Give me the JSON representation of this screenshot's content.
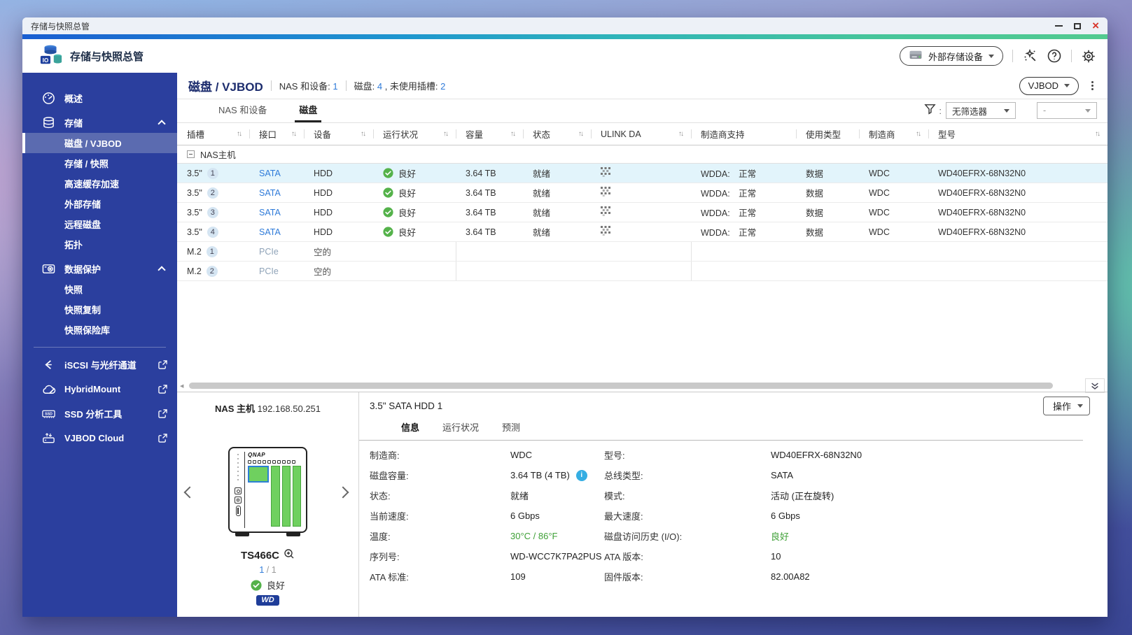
{
  "window": {
    "title": "存储与快照总管"
  },
  "app_header": {
    "title": "存储与快照总管",
    "external_device_button": "外部存储设备",
    "icons": {
      "logo": "storage-io-logo",
      "magic": "wand-icon",
      "help": "question-icon",
      "settings": "gear-icon"
    }
  },
  "sidebar": {
    "items": [
      {
        "label": "概述"
      },
      {
        "label": "存储"
      },
      {
        "label": "磁盘 / VJBOD"
      },
      {
        "label": "存储 / 快照"
      },
      {
        "label": "高速缓存加速"
      },
      {
        "label": "外部存储"
      },
      {
        "label": "远程磁盘"
      },
      {
        "label": "拓扑"
      },
      {
        "label": "数据保护"
      },
      {
        "label": "快照"
      },
      {
        "label": "快照复制"
      },
      {
        "label": "快照保险库"
      },
      {
        "label": "iSCSI 与光纤通道"
      },
      {
        "label": "HybridMount"
      },
      {
        "label": "SSD 分析工具"
      },
      {
        "label": "VJBOD Cloud"
      }
    ]
  },
  "page": {
    "title": "磁盘 / VJBOD",
    "stat_nas_label": "NAS 和设备:",
    "stat_nas_value": "1",
    "stat_disk_label": "磁盘:",
    "stat_disk_value": "4",
    "stat_unused_label": ", 未使用插槽:",
    "stat_unused_value": "2",
    "vjbod_button": "VJBOD"
  },
  "tabs": {
    "devices": "NAS 和设备",
    "disks": "磁盘"
  },
  "filter": {
    "primary": "无筛选器",
    "secondary": "-"
  },
  "table": {
    "group_label": "NAS主机",
    "columns": [
      {
        "label": "插槽"
      },
      {
        "label": "接口"
      },
      {
        "label": "设备"
      },
      {
        "label": "运行状况"
      },
      {
        "label": "容量"
      },
      {
        "label": "状态"
      },
      {
        "label": "ULINK DA"
      },
      {
        "label": "制造商支持"
      },
      {
        "label": "使用类型"
      },
      {
        "label": "制造商"
      },
      {
        "label": "型号"
      }
    ],
    "rows": [
      {
        "slot": "3.5\"",
        "num": "1",
        "iface": "SATA",
        "device": "HDD",
        "health": "良好",
        "capacity": "3.64 TB",
        "status": "就绪",
        "support": "WDDA:　正常",
        "usage": "数据",
        "mfr": "WDC",
        "model": "WD40EFRX-68N32N0"
      },
      {
        "slot": "3.5\"",
        "num": "2",
        "iface": "SATA",
        "device": "HDD",
        "health": "良好",
        "capacity": "3.64 TB",
        "status": "就绪",
        "support": "WDDA:　正常",
        "usage": "数据",
        "mfr": "WDC",
        "model": "WD40EFRX-68N32N0"
      },
      {
        "slot": "3.5\"",
        "num": "3",
        "iface": "SATA",
        "device": "HDD",
        "health": "良好",
        "capacity": "3.64 TB",
        "status": "就绪",
        "support": "WDDA:　正常",
        "usage": "数据",
        "mfr": "WDC",
        "model": "WD40EFRX-68N32N0"
      },
      {
        "slot": "3.5\"",
        "num": "4",
        "iface": "SATA",
        "device": "HDD",
        "health": "良好",
        "capacity": "3.64 TB",
        "status": "就绪",
        "support": "WDDA:　正常",
        "usage": "数据",
        "mfr": "WDC",
        "model": "WD40EFRX-68N32N0"
      },
      {
        "slot": "M.2",
        "num": "1",
        "iface": "PCIe",
        "device": "空的"
      },
      {
        "slot": "M.2",
        "num": "2",
        "iface": "PCIe",
        "device": "空的"
      }
    ]
  },
  "bottom": {
    "nas": {
      "label": "NAS 主机",
      "ip": "192.168.50.251",
      "brand": "QNAP",
      "model": "TS466C",
      "page_current": "1",
      "page_rest": " / 1",
      "health": "良好",
      "wd_logo": "WD"
    },
    "detail": {
      "title": "3.5\" SATA HDD 1",
      "tab_info": "信息",
      "tab_health": "运行状况",
      "tab_predict": "预测",
      "action_button": "操作",
      "fields": [
        {
          "l1": "制造商:",
          "v1": "WDC",
          "l2": "型号:",
          "v2": "WD40EFRX-68N32N0"
        },
        {
          "l1": "磁盘容量:",
          "v1": "3.64 TB (4 TB)",
          "l2": "总线类型:",
          "v2": "SATA"
        },
        {
          "l1": "状态:",
          "v1": "就绪",
          "l2": "模式:",
          "v2": "活动 (正在旋转)"
        },
        {
          "l1": "当前速度:",
          "v1": "6 Gbps",
          "l2": "最大速度:",
          "v2": "6 Gbps"
        },
        {
          "l1": "温度:",
          "v1": "30°C / 86°F",
          "l2": "磁盘访问历史 (I/O):",
          "v2": "良好"
        },
        {
          "l1": "序列号:",
          "v1": "WD-WCC7K7PA2PUS",
          "l2": "ATA 版本:",
          "v2": "10"
        },
        {
          "l1": "ATA 标准:",
          "v1": "109",
          "l2": "固件版本:",
          "v2": "82.00A82"
        }
      ],
      "info_icon": "i"
    }
  },
  "colors": {
    "accent_blue": "#2F7BD9",
    "health_green": "#54B24A",
    "temp_green": "#3FA037",
    "sidebar_blue": "#2B3F9E",
    "sidebar_selected": "#5B6BB0",
    "row_highlight": "#E2F4FB",
    "bay_green": "#6FD05F",
    "wd_navy": "#1F3D99",
    "stripe_gradient": [
      "#1A5ED1",
      "#1E96CF",
      "#46C59B",
      "#52CA90"
    ]
  }
}
